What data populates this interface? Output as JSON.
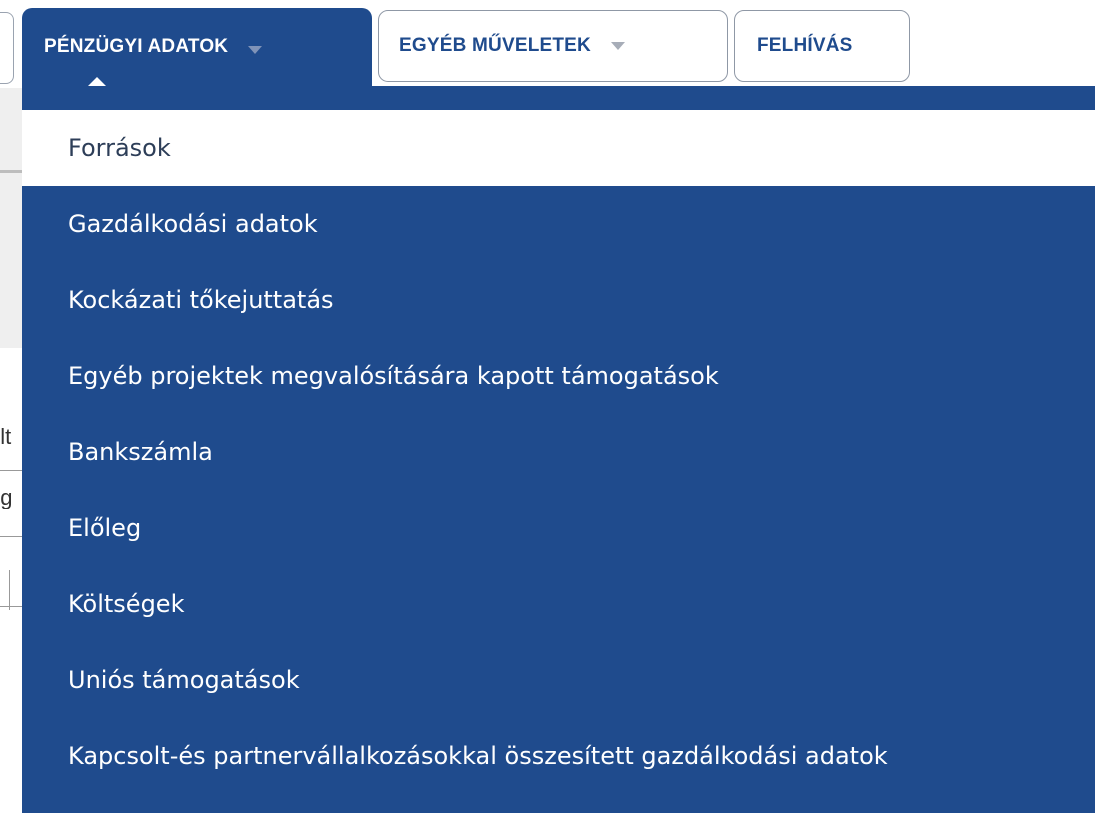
{
  "tabs": [
    {
      "label": "PÉNZÜGYI ADATOK",
      "active": true,
      "has_dropdown": true
    },
    {
      "label": "EGYÉB MŰVELETEK",
      "active": false,
      "has_dropdown": true
    },
    {
      "label": "FELHÍVÁS",
      "active": false,
      "has_dropdown": false
    }
  ],
  "background_fragments": {
    "frag1": "olt",
    "frag2": "ég"
  },
  "menu": {
    "items": [
      {
        "label": "Források",
        "selected": true
      },
      {
        "label": "Gazdálkodási adatok",
        "selected": false
      },
      {
        "label": "Kockázati tőkejuttatás",
        "selected": false
      },
      {
        "label": "Egyéb projektek megvalósítására kapott támogatások",
        "selected": false
      },
      {
        "label": "Bankszámla",
        "selected": false
      },
      {
        "label": "Előleg",
        "selected": false
      },
      {
        "label": "Költségek",
        "selected": false
      },
      {
        "label": "Uniós támogatások",
        "selected": false
      },
      {
        "label": "Kapcsolt-és partnervállalkozásokkal összesített gazdálkodási adatok",
        "selected": false
      }
    ]
  },
  "colors": {
    "primary": "#1f4b8d",
    "menu_text": "#ffffff",
    "selected_bg": "#ffffff",
    "selected_text": "#2d3e58"
  },
  "icons": {
    "dropdown": "chevron-down-icon",
    "pointer": "caret-up-icon"
  }
}
